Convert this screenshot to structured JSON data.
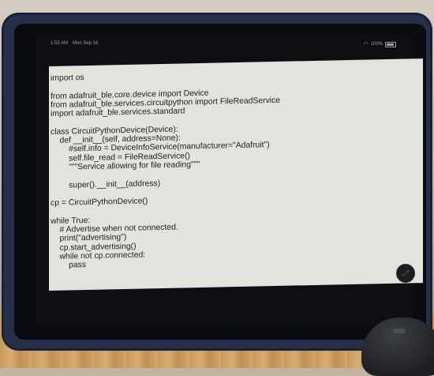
{
  "status_bar": {
    "time": "1:53 AM",
    "date": "Mon Sep 16",
    "battery": "100%"
  },
  "code_lines": [
    "import os",
    "",
    "from adafruit_ble.core.device import Device",
    "from adafruit_ble.services.circuitpython import FileReadService",
    "import adafruit_ble.services.standard",
    "",
    "class CircuitPythonDevice(Device):",
    "    def __init__(self, address=None):",
    "        #self.info = DeviceInfoService(manufacturer=\"Adafruit\")",
    "        self.file_read = FileReadService()",
    "        \"\"\"Service allowing for file reading\"\"\"",
    "",
    "        super().__init__(address)",
    "",
    "cp = CircuitPythonDevice()",
    "",
    "while True:",
    "    # Advertise when not connected.",
    "    print(\"advertising\")",
    "    cp.start_advertising()",
    "    while not cp.connected:",
    "        pass"
  ]
}
